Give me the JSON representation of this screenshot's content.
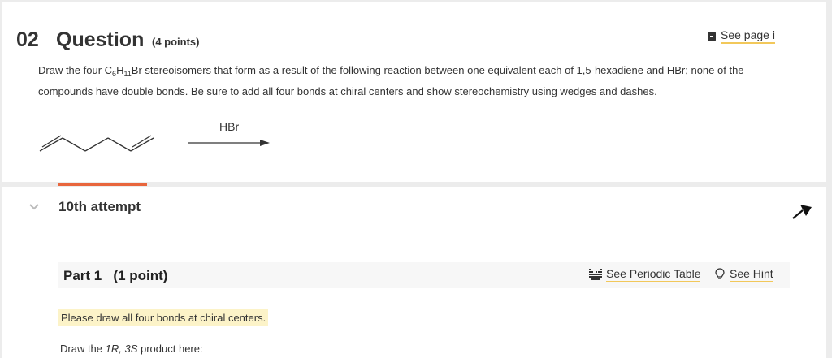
{
  "question": {
    "number": "02",
    "word": "Question",
    "points": "(4 points)",
    "see_page": "See page i",
    "text_pre": "Draw the four C",
    "sub1": "6",
    "text_mid": "H",
    "sub2": "11",
    "text_post": "Br stereoisomers that form as a result of the following reaction between one equivalent each of 1,5-hexadiene and HBr; none of the compounds have double bonds. Be sure to add all four bonds at chiral centers and show stereochemistry using wedges and dashes.",
    "reagent": "HBr"
  },
  "attempt": {
    "label": "10th attempt"
  },
  "part": {
    "title": "Part 1   (1 point)",
    "periodic_table": "See Periodic Table",
    "hint": "See Hint",
    "note": "Please draw all four bonds at chiral centers.",
    "draw_pre": "Draw the ",
    "draw_config": "1R, 3S",
    "draw_post": " product here:"
  },
  "colors": {
    "accent": "#e8663d",
    "highlight": "#fcf3c8",
    "underline": "#f2c85a"
  }
}
